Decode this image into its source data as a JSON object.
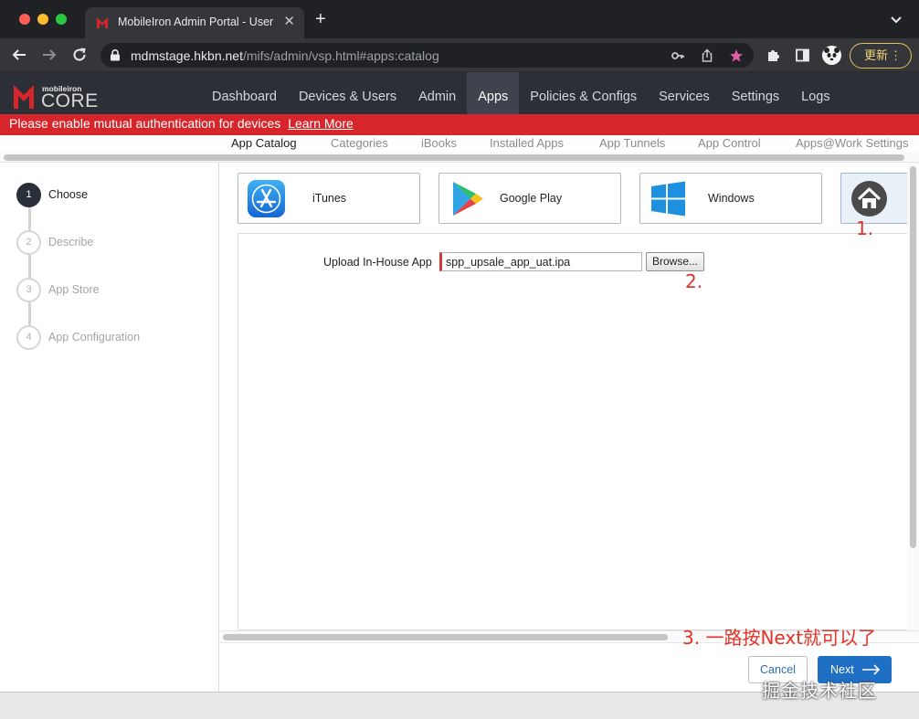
{
  "browser": {
    "tab_title": "MobileIron Admin Portal - User",
    "tab_close": "✕",
    "new_tab": "+",
    "url_host": "mdmstage.hkbn.net",
    "url_path": "/mifs/admin/vsp.html#apps:catalog",
    "update_label": "更新",
    "update_menu": "⋮"
  },
  "header": {
    "logo_small": "mobileiron",
    "logo_core": "CORE",
    "nav": [
      "Dashboard",
      "Devices & Users",
      "Admin",
      "Apps",
      "Policies & Configs",
      "Services",
      "Settings",
      "Logs"
    ],
    "active_nav": "Apps"
  },
  "alert": {
    "message": "Please enable mutual authentication for devices",
    "link": "Learn More"
  },
  "subnav": {
    "items": [
      "App Catalog",
      "Categories",
      "iBooks",
      "Installed Apps",
      "App Tunnels",
      "App Control",
      "Apps@Work Settings"
    ],
    "active": "App Catalog"
  },
  "steps": [
    {
      "num": "1",
      "label": "Choose",
      "active": true
    },
    {
      "num": "2",
      "label": "Describe",
      "active": false
    },
    {
      "num": "3",
      "label": "App Store",
      "active": false
    },
    {
      "num": "4",
      "label": "App Configuration",
      "active": false
    }
  ],
  "stores": [
    {
      "label": "iTunes",
      "icon": "app-store-icon"
    },
    {
      "label": "Google Play",
      "icon": "google-play-icon"
    },
    {
      "label": "Windows",
      "icon": "windows-icon"
    },
    {
      "label": "",
      "icon": "home-icon"
    }
  ],
  "upload": {
    "label": "Upload In-House App",
    "file_value": "spp_upsale_app_uat.ipa",
    "browse_label": "Browse..."
  },
  "footer": {
    "cancel_label": "Cancel",
    "next_label": "Next"
  },
  "annotations": {
    "step1": "1.",
    "step2": "2.",
    "step3": "3. 一路按Next就可以了"
  },
  "watermark": "掘金技术社区",
  "colors": {
    "alert_red": "#d7262b",
    "header_bg": "#2d2f37",
    "primary_blue": "#1f6fc4",
    "annotation_red": "#e0332a"
  }
}
